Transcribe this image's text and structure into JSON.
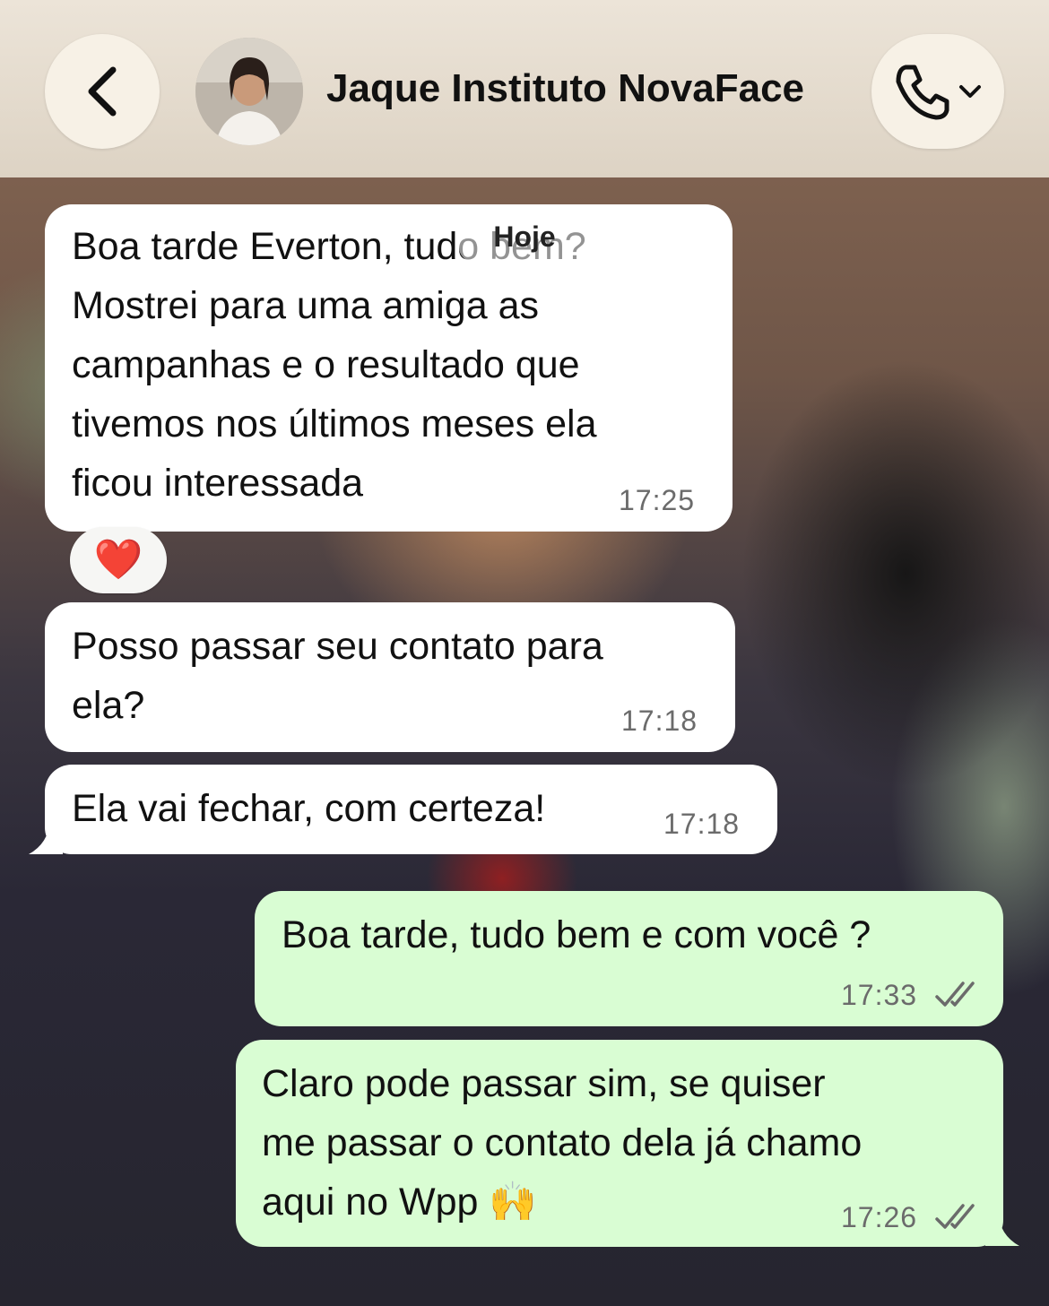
{
  "header": {
    "contact_name": "Jaque Instituto NovaFace",
    "back_icon": "chevron-left-icon",
    "call_icon": "phone-icon",
    "call_menu_icon": "chevron-down-icon"
  },
  "date_separator": "Hoje",
  "messages": [
    {
      "direction": "incoming",
      "lines": [
        "Boa tarde Everton, tudo bem?",
        "Mostrei para uma amiga as",
        "campanhas e o resultado que",
        "tivemos nos últimos meses ela",
        "ficou interessada"
      ],
      "time": "17:25",
      "reaction": "❤️"
    },
    {
      "direction": "incoming",
      "lines": [
        "Posso passar seu contato para",
        "ela?"
      ],
      "time": "17:18"
    },
    {
      "direction": "incoming",
      "lines": [
        "Ela vai fechar, com certeza!"
      ],
      "time": "17:18"
    },
    {
      "direction": "outgoing",
      "lines": [
        "Boa tarde, tudo bem e com você ?"
      ],
      "time": "17:33",
      "status": "read"
    },
    {
      "direction": "outgoing",
      "lines": [
        "Claro pode passar sim, se quiser",
        "me passar o contato dela já chamo",
        "aqui no Wpp 🙌"
      ],
      "time": "17:26",
      "status": "read"
    }
  ],
  "colors": {
    "incoming_bubble": "#ffffff",
    "outgoing_bubble": "#d9fdd3",
    "header_bg": "#e6ddd0",
    "read_ticks": "#6b6b6b"
  }
}
